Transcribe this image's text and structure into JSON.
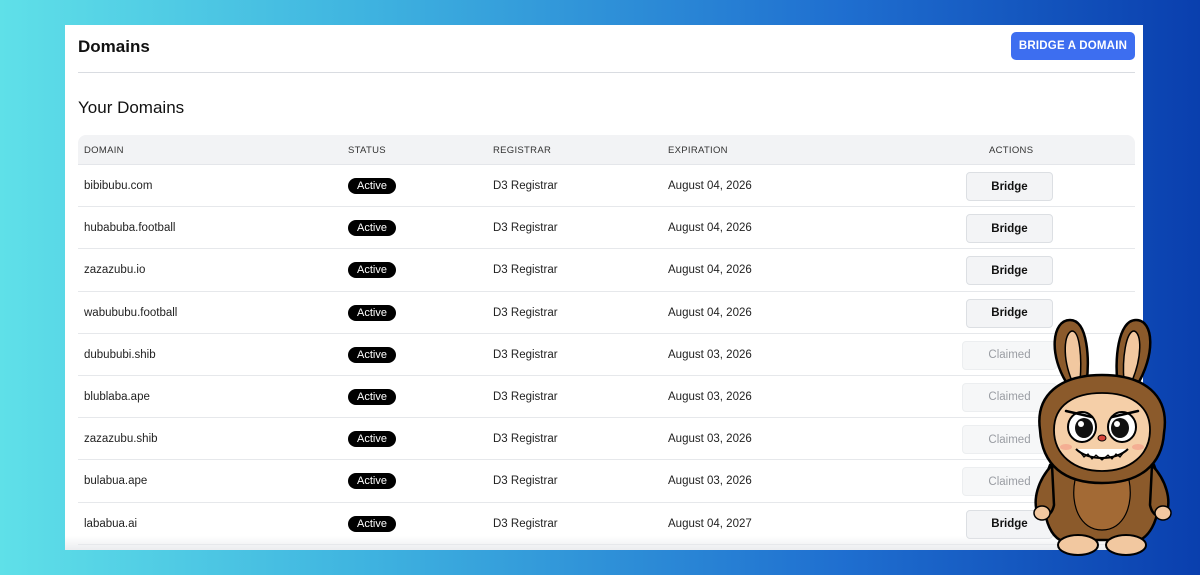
{
  "header": {
    "title": "Domains",
    "bridge_button": "BRIDGE A DOMAIN"
  },
  "section_title": "Your Domains",
  "table": {
    "columns": [
      "DOMAIN",
      "STATUS",
      "REGISTRAR",
      "EXPIRATION",
      "ACTIONS"
    ],
    "rows": [
      {
        "domain": "bibibubu.com",
        "status": "Active",
        "registrar": "D3 Registrar",
        "expiration": "August 04, 2026",
        "action": "Bridge"
      },
      {
        "domain": "hubabuba.football",
        "status": "Active",
        "registrar": "D3 Registrar",
        "expiration": "August 04, 2026",
        "action": "Bridge"
      },
      {
        "domain": "zazazubu.io",
        "status": "Active",
        "registrar": "D3 Registrar",
        "expiration": "August 04, 2026",
        "action": "Bridge"
      },
      {
        "domain": "wabububu.football",
        "status": "Active",
        "registrar": "D3 Registrar",
        "expiration": "August 04, 2026",
        "action": "Bridge"
      },
      {
        "domain": "dubububi.shib",
        "status": "Active",
        "registrar": "D3 Registrar",
        "expiration": "August 03, 2026",
        "action": "Claimed"
      },
      {
        "domain": "blublaba.ape",
        "status": "Active",
        "registrar": "D3 Registrar",
        "expiration": "August 03, 2026",
        "action": "Claimed"
      },
      {
        "domain": "zazazubu.shib",
        "status": "Active",
        "registrar": "D3 Registrar",
        "expiration": "August 03, 2026",
        "action": "Claimed"
      },
      {
        "domain": "bulabua.ape",
        "status": "Active",
        "registrar": "D3 Registrar",
        "expiration": "August 03, 2026",
        "action": "Claimed"
      },
      {
        "domain": "lababua.ai",
        "status": "Active",
        "registrar": "D3 Registrar",
        "expiration": "August 04, 2027",
        "action": "Bridge"
      }
    ]
  },
  "colors": {
    "accent": "#3d6ef0",
    "badge": "#000000"
  },
  "mascot_icon": "furry-monster-icon"
}
